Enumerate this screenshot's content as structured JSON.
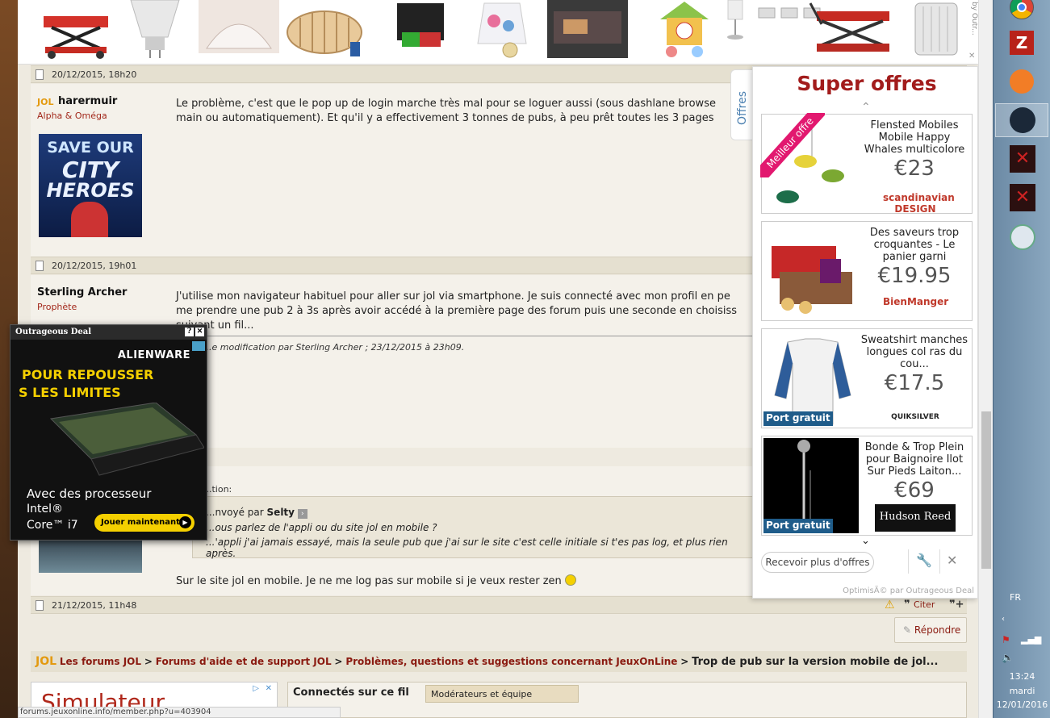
{
  "top_ad": {
    "side_text": "by Outr..."
  },
  "posts": [
    {
      "date": "20/12/2015, 18h20"
    },
    {
      "username": "harermuir",
      "rank": "Alpha & Oméga",
      "avatar_text": [
        "SAVE OUR",
        "CITY",
        "HEROES"
      ],
      "text_line1": "Le problème, c'est que le pop up de login marche très mal pour se loguer aussi (sous dashlane browse",
      "text_line2": "main ou automatiquement). Et qu'il y a effectivement 3 tonnes de pubs, à peu prêt toutes les 3 pages"
    },
    {
      "date": "20/12/2015, 19h01"
    },
    {
      "username": "Sterling Archer",
      "rank": "Prophète",
      "text_line1": "J'utilise mon navigateur habituel pour aller sur jol via smartphone. Je suis connecté avec mon profil en pe",
      "text_line2": "me prendre une pub 2 à 3s après avoir accédé à la première page des forum puis une seconde en choisiss",
      "text_line3": "suivant un fil...",
      "edit_note": "...e modification par Sterling Archer ; 23/12/2015 à 23h09."
    },
    {
      "quote_label": "...tion:",
      "quote_sent_by": "...nvoyé par",
      "quote_author": "Selty",
      "quote_line1": "...ous parlez de l'appli ou du site jol en mobile ?",
      "quote_line2": "...'appli j'ai jamais essayé, mais la seule pub que j'ai sur le site c'est celle initiale si t'es pas log, et plus rien après.",
      "reply": "Sur le site jol en mobile. Je ne me log pas sur mobile si je veux rester zen",
      "date": "21/12/2015, 11h48",
      "citer": "Citer"
    }
  ],
  "reply_button": "Répondre",
  "breadcrumb": {
    "logo": "JOL",
    "items": [
      "Les forums JOL",
      "Forums d'aide et de support JOL",
      "Problèmes, questions et suggestions concernant JeuxOnLine"
    ],
    "sep": ">",
    "current": "Trop de pub sur la version mobile de jol..."
  },
  "bottom": {
    "simulateur": "Simulateur",
    "connected": "Connectés sur ce fil",
    "moderators": "Modérateurs et équipe"
  },
  "status_url": "forums.jeuxonline.info/member.php?u=403904",
  "super_offres": {
    "tab": "Offres",
    "title": "Super offres",
    "badge": "Meilleur offre",
    "offers": [
      {
        "title": "Flensted Mobiles Mobile Happy Whales multicolore",
        "price": "€23",
        "brand": "scandinavian DESIGN"
      },
      {
        "title": "Des saveurs trop croquantes - Le panier garni",
        "price": "€19.95",
        "brand": "BienManger"
      },
      {
        "title": "Sweatshirt manches longues col ras du cou...",
        "price": "€17.5",
        "badge": "Port gratuit",
        "brand": "QUIKSILVER"
      },
      {
        "title": "Bonde & Trop Plein pour Baignoire Ilot Sur Pieds Laiton...",
        "price": "€69",
        "badge": "Port gratuit",
        "brand": "Hudson Reed"
      }
    ],
    "more_button": "Recevoir plus d'offres",
    "footer": "OptimisÃ© par Outrageous Deal"
  },
  "alien_ad": {
    "header": "Outrageous Deal",
    "brand": "ALIENWARE",
    "line1": "POUR REPOUSSER",
    "line2": "S LES LIMITES",
    "sub1": "Avec des processeur",
    "sub2": "Intel®",
    "sub3": "Core™ i7",
    "cta": "Jouer maintenant"
  },
  "taskbar": {
    "lang": "FR",
    "time": "13:24",
    "day": "mardi",
    "date": "12/01/2016"
  },
  "colors": {
    "forum_bg": "#eeeae0",
    "rank_red": "#a2281b",
    "offres_red": "#a21c1c",
    "alien_yellow": "#f5d000",
    "taskbar": "#7f9db6"
  }
}
